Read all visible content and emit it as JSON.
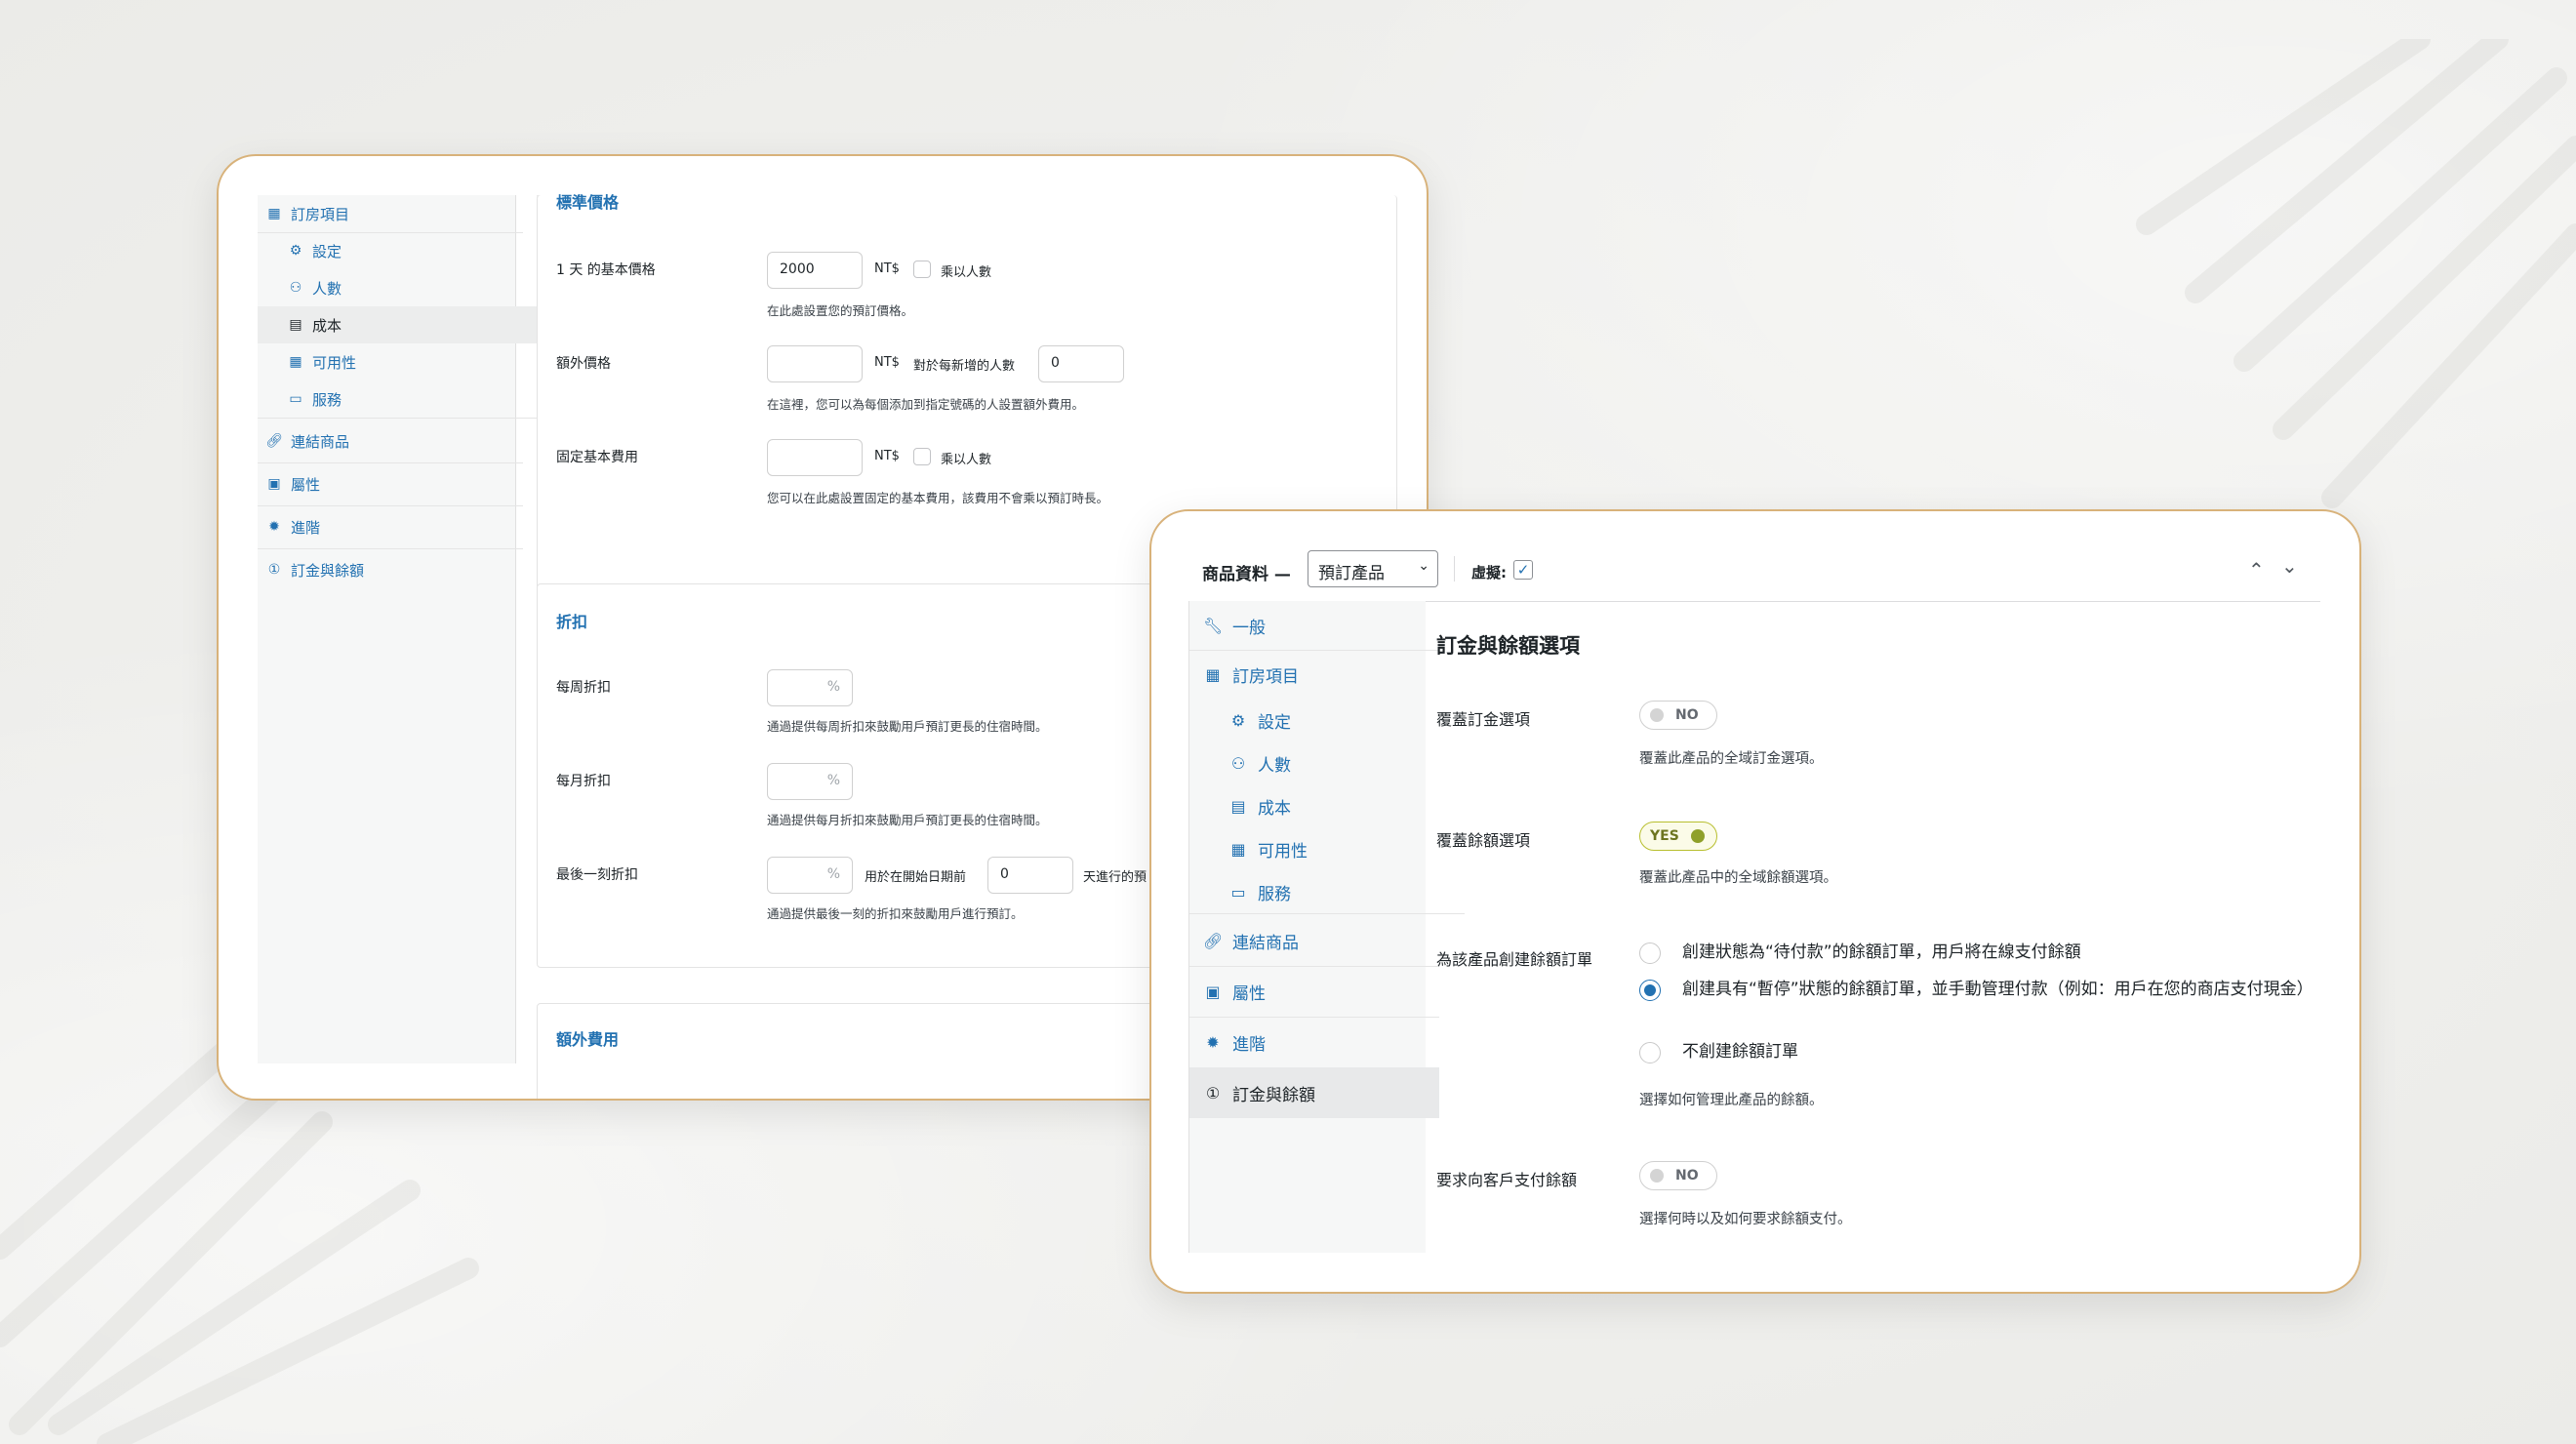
{
  "card1": {
    "sidebar": [
      {
        "label": "訂房項目",
        "icon": "calendar-icon",
        "kind": "top"
      },
      {
        "label": "設定",
        "icon": "gear-icon",
        "kind": "sub"
      },
      {
        "label": "人數",
        "icon": "people-icon",
        "kind": "sub"
      },
      {
        "label": "成本",
        "icon": "chart-icon",
        "kind": "sub",
        "active": true
      },
      {
        "label": "可用性",
        "icon": "calendar-icon",
        "kind": "sub"
      },
      {
        "label": "服務",
        "icon": "window-icon",
        "kind": "sub"
      },
      {
        "label": "連結商品",
        "icon": "link-icon",
        "kind": "top"
      },
      {
        "label": "屬性",
        "icon": "table-icon",
        "kind": "top"
      },
      {
        "label": "進階",
        "icon": "gear-icon",
        "kind": "top"
      },
      {
        "label": "訂金與餘額",
        "icon": "coin-icon",
        "kind": "top"
      }
    ],
    "standard_price": {
      "heading": "標準價格",
      "base_label": "1 天 的基本價格",
      "base_value": "2000",
      "currency": "NT$",
      "multiply_label": "乘以人數",
      "base_desc": "在此處設置您的預訂價格。",
      "extra_label": "額外價格",
      "extra_value": "",
      "per_person_label": "對於每新增的人數",
      "per_person_value": "0",
      "extra_desc": "在這裡，您可以為每個添加到指定號碼的人設置額外費用。",
      "fixed_label": "固定基本費用",
      "fixed_value": "",
      "fixed_desc": "您可以在此處設置固定的基本費用，該費用不會乘以預訂時長。"
    },
    "discount": {
      "heading": "折扣",
      "weekly_label": "每周折扣",
      "percent": "%",
      "weekly_desc": "通過提供每周折扣來鼓勵用戶預訂更長的住宿時間。",
      "monthly_label": "每月折扣",
      "monthly_desc": "通過提供每月折扣來鼓勵用戶預訂更長的住宿時間。",
      "lastminute_label": "最後一刻折扣",
      "before_label": "用於在開始日期前",
      "before_value": "0",
      "after_label": "天進行的預",
      "lastminute_desc": "通過提供最後一刻的折扣來鼓勵用戶進行預訂。"
    },
    "extra_fees_heading": "額外費用"
  },
  "card2": {
    "header": {
      "product_data_label": "商品資料 —",
      "product_type": "預訂產品",
      "virtual_label": "虛擬:"
    },
    "sidebar": [
      {
        "label": "一般",
        "icon": "wrench-icon",
        "kind": "top"
      },
      {
        "label": "訂房項目",
        "icon": "calendar-icon",
        "kind": "top2"
      },
      {
        "label": "設定",
        "icon": "gear-icon",
        "kind": "sub"
      },
      {
        "label": "人數",
        "icon": "people-icon",
        "kind": "sub"
      },
      {
        "label": "成本",
        "icon": "chart-icon",
        "kind": "sub"
      },
      {
        "label": "可用性",
        "icon": "calendar-icon",
        "kind": "sub"
      },
      {
        "label": "服務",
        "icon": "window-icon",
        "kind": "sub"
      },
      {
        "label": "連結商品",
        "icon": "link-icon",
        "kind": "top"
      },
      {
        "label": "屬性",
        "icon": "table-icon",
        "kind": "top"
      },
      {
        "label": "進階",
        "icon": "gear-icon",
        "kind": "top"
      },
      {
        "label": "訂金與餘額",
        "icon": "coin-icon",
        "kind": "top",
        "active": true
      }
    ],
    "panel": {
      "title": "訂金與餘額選項",
      "override_deposit_label": "覆蓋訂金選項",
      "override_deposit_toggle": "NO",
      "override_deposit_desc": "覆蓋此產品的全域訂金選項。",
      "override_balance_label": "覆蓋餘額選項",
      "override_balance_toggle": "YES",
      "override_balance_desc": "覆蓋此產品中的全域餘額選項。",
      "create_order_label": "為該產品創建餘額訂單",
      "radio_options": [
        {
          "text": "創建狀態為“待付款”的餘額訂單，用戶將在線支付餘額",
          "selected": false
        },
        {
          "text": "創建具有“暫停”狀態的餘額訂單，並手動管理付款（例如：用戶在您的商店支付現金）",
          "selected": true
        },
        {
          "text": "不創建餘額訂單",
          "selected": false
        }
      ],
      "create_order_desc": "選擇如何管理此產品的餘額。",
      "require_payment_label": "要求向客戶支付餘額",
      "require_payment_toggle": "NO",
      "require_payment_desc": "選擇何時以及如何要求餘額支付。"
    }
  }
}
